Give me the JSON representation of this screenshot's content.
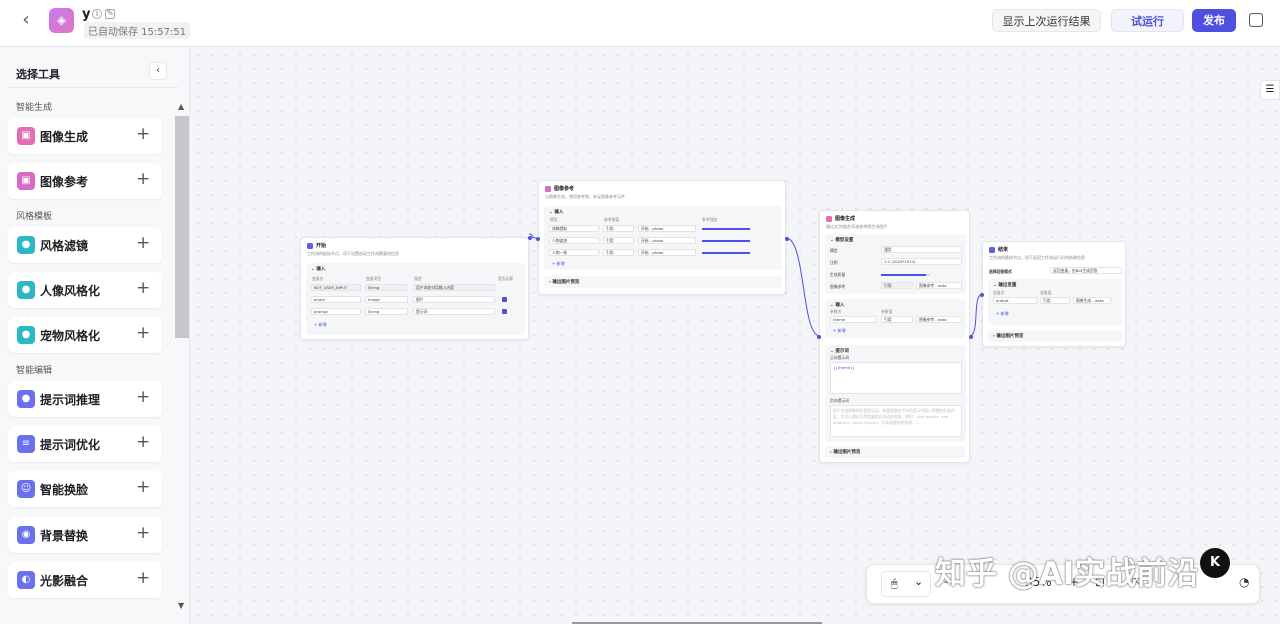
{
  "header": {
    "back": "‹",
    "app_icon": "◈",
    "app_name": "y",
    "autosave": "已自动保存 15:57:51",
    "btn_last_result": "显示上次运行结果",
    "btn_test_run": "试运行",
    "btn_publish": "发布"
  },
  "sidebar": {
    "title": "选择工具",
    "collapse": "‹",
    "categories": {
      "gen": "智能生成",
      "style": "风格模板",
      "edit": "智能编辑"
    },
    "items": [
      {
        "label": "图像生成",
        "color": "#e26fb4"
      },
      {
        "label": "图像参考",
        "color": "#d56bc2"
      },
      {
        "label": "风格滤镜",
        "color": "#2bb9c8"
      },
      {
        "label": "人像风格化",
        "color": "#2bb9c8"
      },
      {
        "label": "宠物风格化",
        "color": "#2bb9c8"
      },
      {
        "label": "提示词推理",
        "color": "#6b70ef"
      },
      {
        "label": "提示词优化",
        "color": "#6b70ef"
      },
      {
        "label": "智能换脸",
        "color": "#6b70ef"
      },
      {
        "label": "背景替换",
        "color": "#6b70ef"
      },
      {
        "label": "光影融合",
        "color": "#6b70ef"
      }
    ],
    "plus": "+"
  },
  "nodes": {
    "start": {
      "title": "开始",
      "desc": "工作流的起始节点，用于设置启动工作流需要的信息",
      "section": "输入",
      "col_name": "变量名",
      "col_type": "变量类型",
      "col_desc": "描述",
      "col_req": "是否必要",
      "rows": [
        {
          "name": "BOT_USER_INPUT",
          "type": "String",
          "desc": "用户本轮对话输入内容"
        },
        {
          "name": "photo",
          "type": "Image",
          "desc": "图片"
        },
        {
          "name": "prompt",
          "type": "String",
          "desc": "提示词"
        }
      ],
      "add": "+ 新增"
    },
    "ref": {
      "title": "图像参考",
      "desc": "以图像生成，使用参考图，补足图像参考元件",
      "section": "输入",
      "col_ref": "模型",
      "col_val": "参考图值",
      "col_str": "参考强度",
      "rows": [
        {
          "model": "线稿提取",
          "mode": "引用",
          "val": "开始 - photo"
        },
        {
          "model": "人物姿态",
          "mode": "引用",
          "val": "开始 - photo"
        },
        {
          "model": "人物一致",
          "mode": "引用",
          "val": "开始 - photo"
        }
      ],
      "add": "+ 新增",
      "output": "输出图片预览"
    },
    "gen": {
      "title": "图像生成",
      "desc": "通过文字描述/添加参考图生成图片",
      "section_model": "模型设置",
      "model_label": "模型",
      "model_value": "通用",
      "ratio_label": "比例",
      "ratio_value": "1:1 (1024*1024)",
      "quality_label": "生成质量",
      "ref_label": "图像参考",
      "ref_mode": "引用",
      "ref_value": "图像参考 - data",
      "section_input": "输入",
      "input_name_col": "参数名",
      "input_val_col": "参数值",
      "input_name": "theme",
      "input_mode": "引用",
      "input_value": "图像参考 - data",
      "add": "+ 新增",
      "section_prompt": "提示词",
      "pos_label": "正向提示词",
      "pos_value": "{{theme}}",
      "neg_label": "负向提示词",
      "neg_placeholder": "用于生成图像的负面提示词，如需提取在写作的提示中填入期望的负面内容，也可以通过引用变量的方式动态添加，例如：(low quality, bad anatomy, extra fingers)，以实现更好的效果……",
      "output": "输出图片预览"
    },
    "end": {
      "title": "结束",
      "desc": "工作流的最终节点，用于返回工作流运行后的结果信息",
      "mode_label": "选择回答模式",
      "mode_value": "返回变量，由Bot生成回答",
      "section": "输出变量",
      "var_col": "变量名",
      "val_col": "变量值",
      "var_name": "output",
      "var_mode": "引用",
      "var_value": "图像生成 - data",
      "add": "+ 新增",
      "output": "输出图片预览"
    }
  },
  "bottom_bar": {
    "mouse": "🖱",
    "chevron": "⌄",
    "zoom": "35%"
  },
  "watermark": "知乎 @AI实战前沿",
  "watermark_logo": "K"
}
